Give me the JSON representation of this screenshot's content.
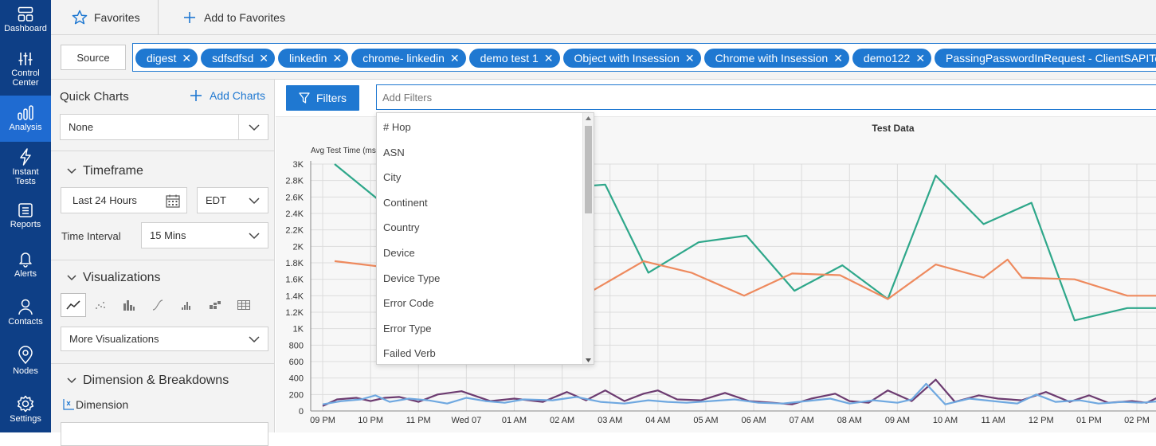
{
  "rail": [
    {
      "label": "Dashboard",
      "icon": "dashboard-icon"
    },
    {
      "label": "Control Center",
      "icon": "sliders-icon"
    },
    {
      "label": "Analysis",
      "icon": "bar-chart-icon",
      "active": true
    },
    {
      "label": "Instant Tests",
      "icon": "lightning-icon"
    },
    {
      "label": "Reports",
      "icon": "report-icon"
    },
    {
      "label": "Alerts",
      "icon": "bell-icon"
    },
    {
      "label": "Contacts",
      "icon": "person-icon"
    },
    {
      "label": "Nodes",
      "icon": "location-pin-icon"
    },
    {
      "label": "Settings",
      "icon": "gear-icon"
    }
  ],
  "topbar": {
    "favorites_label": "Favorites",
    "add_favorites_label": "Add to Favorites"
  },
  "source": {
    "label": "Source"
  },
  "chips": [
    "digest",
    "sdfsdfsd",
    "linkedin",
    "chrome- linkedin",
    "demo test 1",
    "Object with Insession",
    "Chrome with Insession",
    "demo122",
    "PassingPasswordInRequest - ClientSAPITest"
  ],
  "panel": {
    "quick_charts": "Quick Charts",
    "add_charts": "Add Charts",
    "quick_select": "None",
    "timeframe": "Timeframe",
    "timeframe_value": "Last 24 Hours",
    "timezone": "EDT",
    "interval_label": "Time Interval",
    "interval_value": "15 Mins",
    "visualizations": "Visualizations",
    "more_viz": "More Visualizations",
    "dimension_title": "Dimension & Breakdowns",
    "dimension_label": "Dimension"
  },
  "filters": {
    "button": "Filters",
    "placeholder": "Add Filters"
  },
  "dropdown_items": [
    "# Hop",
    "ASN",
    "City",
    "Continent",
    "Country",
    "Device",
    "Device Type",
    "Error Code",
    "Error Type",
    "Failed Verb"
  ],
  "colors": {
    "rail": "#0e3f86",
    "accent": "#1f78d1",
    "teal": "#2ea78a",
    "orange": "#ee8a5e",
    "purple": "#6c3b70",
    "blue": "#6fa8e0"
  },
  "chart_data": {
    "type": "line",
    "title": "Test Data",
    "ylabel": "Avg Test Time (ms)",
    "ylim": [
      0,
      3000
    ],
    "yticks": [
      "0",
      "200",
      "400",
      "600",
      "800",
      "1K",
      "1.2K",
      "1.4K",
      "1.6K",
      "1.8K",
      "2K",
      "2.2K",
      "2.4K",
      "2.6K",
      "2.8K",
      "3K"
    ],
    "xticks": [
      "09 PM",
      "10 PM",
      "11 PM",
      "Wed 07",
      "01 AM",
      "02 AM",
      "03 AM",
      "04 AM",
      "05 AM",
      "06 AM",
      "07 AM",
      "08 AM",
      "09 AM",
      "10 AM",
      "11 AM",
      "12 PM",
      "01 PM",
      "02 PM"
    ],
    "grid": true,
    "series": [
      {
        "color": "#2ea78a",
        "x": [
          0.25,
          1.2,
          5.9,
          6.8,
          7.85,
          8.85,
          9.85,
          10.85,
          11.8,
          12.8,
          13.8,
          14.8,
          15.7,
          16.8,
          17.5
        ],
        "values": [
          3000,
          2550,
          2750,
          1680,
          2050,
          2130,
          1460,
          1770,
          1360,
          2860,
          2270,
          2530,
          1100,
          1250,
          1250
        ]
      },
      {
        "color": "#ee8a5e",
        "x": [
          0.25,
          5.6,
          6.7,
          7.7,
          8.8,
          9.8,
          10.8,
          11.8,
          12.8,
          13.8,
          14.3,
          14.6,
          15.7,
          16.8,
          17.5
        ],
        "values": [
          1820,
          1450,
          1820,
          1680,
          1400,
          1670,
          1650,
          1360,
          1780,
          1620,
          1840,
          1620,
          1600,
          1400,
          1400
        ]
      },
      {
        "color": "#6c3b70",
        "x": [
          0.0,
          0.3,
          0.7,
          1.0,
          1.3,
          1.6,
          2.0,
          2.4,
          2.9,
          3.5,
          4.0,
          4.6,
          5.1,
          5.5,
          5.9,
          6.3,
          6.7,
          7.0,
          7.4,
          7.9,
          8.4,
          8.9,
          9.4,
          9.8,
          10.2,
          10.7,
          11.0,
          11.4,
          11.8,
          12.3,
          12.8,
          13.2,
          13.7,
          14.1,
          14.6,
          15.1,
          15.6,
          16.0,
          16.4,
          16.9,
          17.2,
          17.5
        ],
        "values": [
          60,
          140,
          160,
          120,
          160,
          170,
          110,
          200,
          240,
          120,
          150,
          110,
          230,
          130,
          250,
          120,
          210,
          250,
          140,
          130,
          220,
          120,
          100,
          80,
          150,
          210,
          120,
          100,
          250,
          120,
          380,
          110,
          190,
          150,
          130,
          230,
          110,
          190,
          100,
          120,
          100,
          180
        ]
      },
      {
        "color": "#6fa8e0",
        "x": [
          0.0,
          0.4,
          0.8,
          1.1,
          1.4,
          1.8,
          2.2,
          2.6,
          3.0,
          3.4,
          3.8,
          4.2,
          4.8,
          5.3,
          5.8,
          6.3,
          6.8,
          7.2,
          7.6,
          8.1,
          8.6,
          9.1,
          9.6,
          10.1,
          10.6,
          11.0,
          11.5,
          12.0,
          12.3,
          12.6,
          13.0,
          13.5,
          14.0,
          14.5,
          14.9,
          15.3,
          15.8,
          16.2,
          16.7,
          17.1,
          17.5
        ],
        "values": [
          80,
          120,
          140,
          190,
          110,
          150,
          130,
          90,
          160,
          120,
          100,
          140,
          130,
          170,
          110,
          90,
          130,
          110,
          100,
          120,
          140,
          100,
          90,
          120,
          150,
          90,
          130,
          100,
          140,
          330,
          80,
          150,
          120,
          90,
          200,
          110,
          130,
          90,
          110,
          100,
          120
        ]
      }
    ]
  }
}
